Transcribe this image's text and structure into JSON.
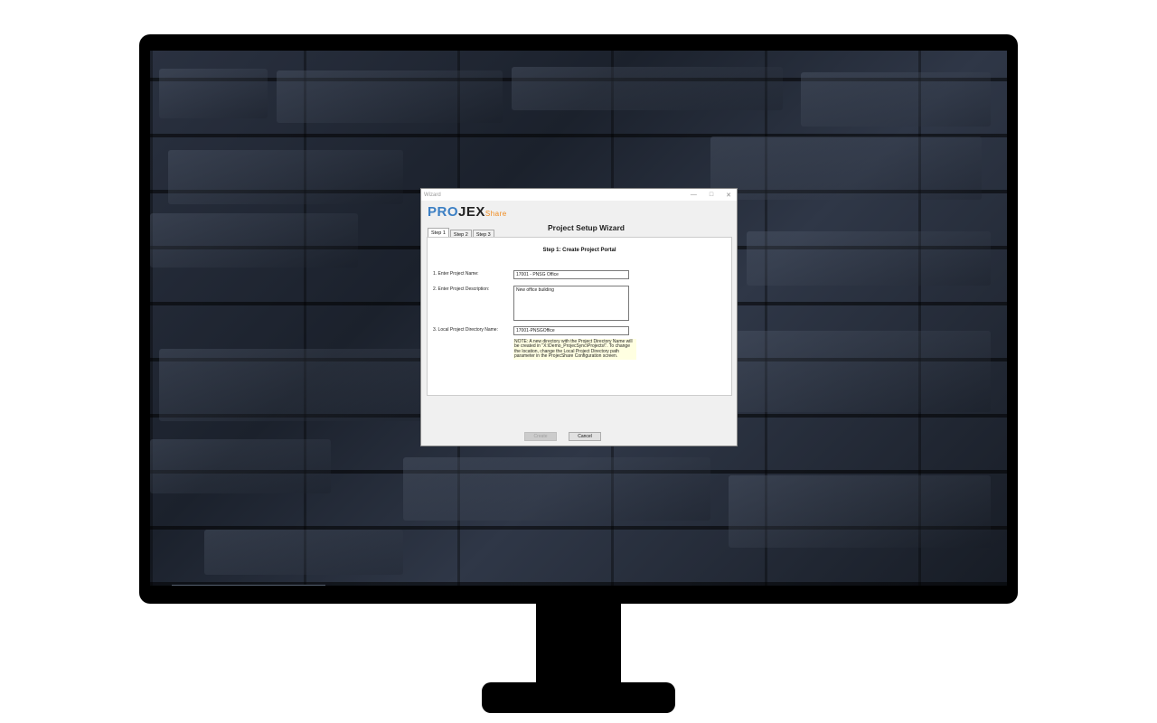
{
  "window": {
    "title": "Wizard",
    "minimize": "—",
    "maximize": "□",
    "close": "✕"
  },
  "logo": {
    "part1": "PRO",
    "part2": "JEX",
    "part3": "Share"
  },
  "wizard_title": "Project Setup Wizard",
  "tabs": [
    {
      "label": "Step 1"
    },
    {
      "label": "Step 2"
    },
    {
      "label": "Step 3"
    }
  ],
  "step_title": "Step 1: Create Project Portal",
  "form": {
    "project_name_label": "1. Enter Project Name:",
    "project_name_value": "17001 - PNSG Office",
    "project_desc_label": "2. Enter Project Description:",
    "project_desc_value": "New office  building",
    "local_dir_label": "3. Local Project Directory Name:",
    "local_dir_value": "17001-PNSGOffice",
    "note": "NOTE: A new directory with the Project Directory Name will be created in \"X:\\Demo_ProjecSync\\Projects\\\". To change the location, change the Local Project Directory path parameter in the ProjecShare Configuration screen."
  },
  "buttons": {
    "create": "Create",
    "cancel": "Cancel"
  }
}
